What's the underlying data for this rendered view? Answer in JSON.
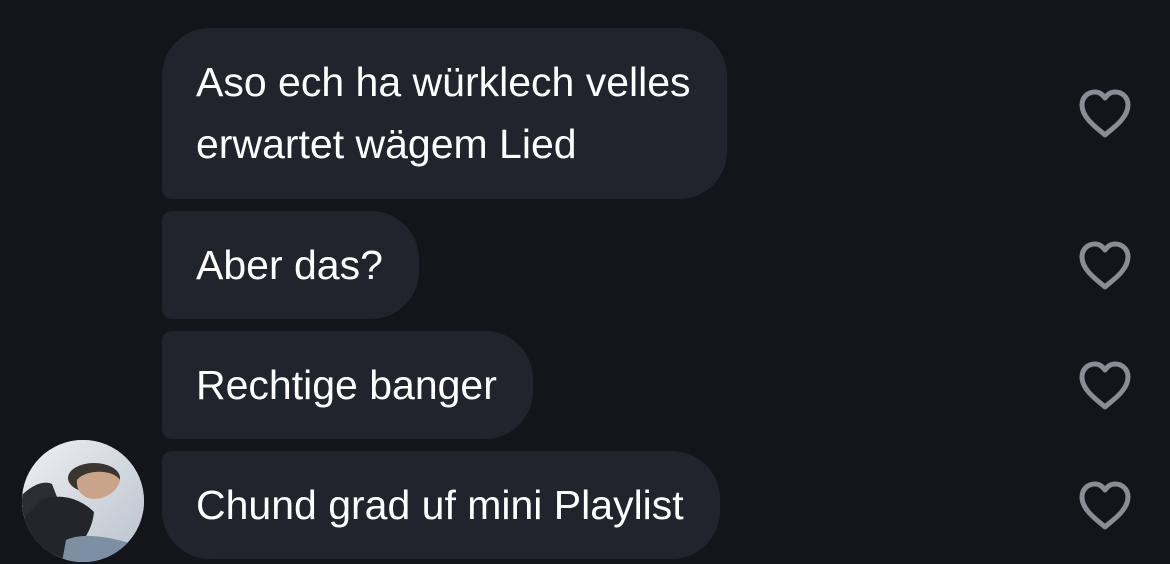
{
  "messages": [
    {
      "text": "Aso ech ha würklech velles\nerwartet wägem Lied",
      "liked": false
    },
    {
      "text": "Aber das?",
      "liked": false
    },
    {
      "text": "Rechtige banger",
      "liked": false
    },
    {
      "text": "Chund grad uf mini Playlist",
      "liked": false
    }
  ],
  "icons": {
    "like": "heart-outline-icon",
    "avatar": "sender-avatar-photo"
  },
  "colors": {
    "background": "#14151a",
    "bubble": "#22242d",
    "text": "#ffffff",
    "heart_outline": "#8a8d96"
  }
}
